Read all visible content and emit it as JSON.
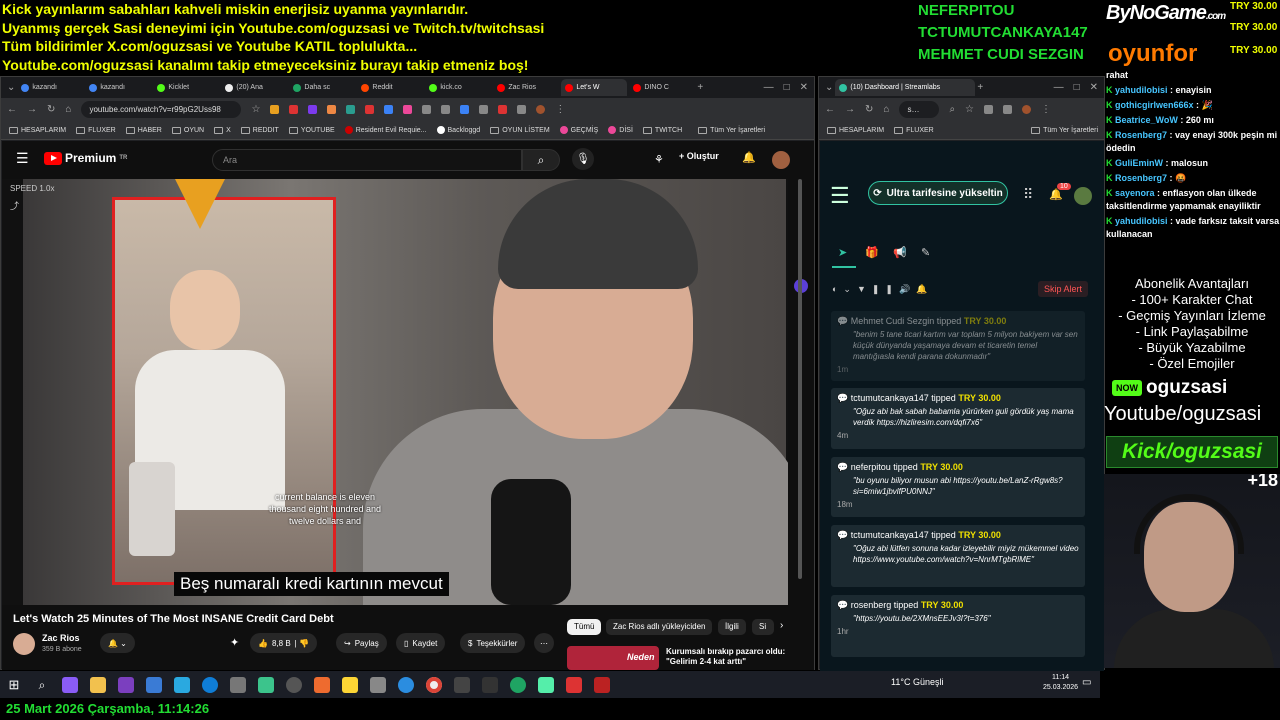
{
  "overlay": {
    "top_lines": [
      "Kick yayınlarım sabahları kahveli miskin enerjisiz uyanma yayınlarıdır.",
      "Uyanmış gerçek Sasi deneyimi için Youtube.com/oguzsasi ve Twitch.tv/twitchsasi",
      "Tüm bildirimler X.com/oguzsasi ve Youtube KATIL toplulukta...",
      "Youtube.com/oguzsasi kanalımı takip etmeyeceksiniz burayı takip etmeniz boş!"
    ],
    "top_donors": [
      "NEFERPITOU",
      "TCTUMUTCANKAYA147",
      "MEHMET CUDI SEZGIN"
    ],
    "sponsor_1": "ByNoGame",
    "sponsor_1_sub": ".com",
    "sponsor_2": "oyunfor",
    "tip_tags": [
      "TRY 30.00",
      "TRY 30.00",
      "TRY 30.00"
    ],
    "date_line": "25 Mart 2026 Çarşamba, 11:14:26"
  },
  "browser_left": {
    "tabs": [
      "kazandı",
      "kazandı",
      "Kicklet",
      "(20) Ana",
      "Daha sc",
      "Reddit",
      "kick.co",
      "Zac Rios",
      "Let's W",
      "DINO C"
    ],
    "url": "youtube.com/watch?v=r99pG2Uss98",
    "bookmarks": [
      "HESAPLARIM",
      "FLUXER",
      "HABER",
      "OYUN",
      "X",
      "REDDIT",
      "YOUTUBE",
      "Resident Evil Requie...",
      "Backloggd",
      "OYUN LİSTEM",
      "GEÇMİŞ",
      "DİSİ",
      "TWITCH",
      "Tüm Yer İşaretleri"
    ]
  },
  "youtube": {
    "brand": "Premium",
    "brand_sup": "TR",
    "search_placeholder": "Ara",
    "create_label": "Oluştur",
    "speed": "SPEED 1.0x",
    "inset_caption": "current balance is eleven thousand eight hundred and twelve dollars and",
    "subtitle": "Beş numaralı kredi kartının mevcut",
    "video_title": "Let's Watch 25 Minutes of The Most INSANE Credit Card Debt",
    "channel": "Zac Rios",
    "subscribers": "359 B abone",
    "likes": "8,8 B",
    "share_label": "Paylaş",
    "save_label": "Kaydet",
    "thanks_label": "Teşekkürler",
    "chips": [
      "Tümü",
      "Zac Rios adlı yükleyiciden",
      "İlgili",
      "Si"
    ],
    "rec_title": "Kurumsalı bırakıp pazarcı oldu: \"Gelirim 2-4 kat arttı\"",
    "rec_thumb_label": "Neden"
  },
  "browser_right": {
    "tab_title": "(10) Dashboard | Streamlabs",
    "bookmarks": [
      "HESAPLARIM",
      "FLUXER",
      "Tüm Yer İşaretleri"
    ]
  },
  "streamlabs": {
    "upgrade_label": "Ultra tarifesine yükseltin",
    "notif_count": "10",
    "skip_label": "Skip Alert",
    "tips": [
      {
        "user": "Mehmet Cudi Sezgin",
        "verb": "tipped",
        "amount": "TRY 30.00",
        "message": "\"benim 5 tane ticari kartım var toplam 5 milyon bakiyem var sen küçük dünyanda yaşamaya devam et ticaretin temel mantığıasla kendi parana dokunmadır\"",
        "ago": "1m",
        "faded": true
      },
      {
        "user": "tctumutcankaya147",
        "verb": "tipped",
        "amount": "TRY 30.00",
        "message": "\"Oğuz abi bak sabah babamla yürürken guli gördük yaş mama verdik https://hizliresim.com/dqfi7x6\"",
        "ago": "4m",
        "faded": false
      },
      {
        "user": "neferpitou",
        "verb": "tipped",
        "amount": "TRY 30.00",
        "message": "\"bu oyunu biliyor musun abi https://youtu.be/LanZ-rRgw8s?si=6miw1jbvlfPU0NNJ\"",
        "ago": "18m",
        "faded": false
      },
      {
        "user": "tctumutcankaya147",
        "verb": "tipped",
        "amount": "TRY 30.00",
        "message": "\"Oğuz abi lütfen sonuna kadar izleyebilir miyiz mükemmel video https://www.youtube.com/watch?v=NnrMTgbRlME\"",
        "ago": "21m",
        "faded": false
      },
      {
        "user": "rosenberg",
        "verb": "tipped",
        "amount": "TRY 30.00",
        "message": "\"https://youtu.be/2XMnsEEJv3I?t=376\"",
        "ago": "1hr",
        "faded": false
      }
    ]
  },
  "chat": {
    "messages": [
      {
        "user": "",
        "text": "rahat"
      },
      {
        "user": "yahudilobisi",
        "text": " : enayisin"
      },
      {
        "user": "gothicgirlwen666x",
        "text": " : 🎉"
      },
      {
        "user": "Beatrice_WoW",
        "text": " : 260 mı"
      },
      {
        "user": "Rosenberg7",
        "text": " : vay enayi 300k peşin mi ödedin"
      },
      {
        "user": "GuliEminW",
        "text": " : malosun"
      },
      {
        "user": "Rosenberg7",
        "text": " : 🤬"
      },
      {
        "user": "sayenora",
        "text": " : enflasyon olan ülkede taksitlendirme yapmamak enayiliktir"
      },
      {
        "user": "yahudilobisi",
        "text": " : vade farksız taksit varsa kullanacan"
      }
    ],
    "perks": [
      "Abonelik Avantajları",
      "- 100+ Karakter Chat",
      "- Geçmiş Yayınları İzleme",
      "- Link Paylaşabilme",
      "- Büyük Yazabilme",
      "- Özel Emojiler"
    ],
    "kick_badge": "NOW",
    "handle": "oguzsasi",
    "youtube_line": "Youtube/oguzsasi",
    "kick_line": "Kick/oguzsasi",
    "viewer_badge": "+18"
  },
  "taskbar": {
    "weather": "11°C  Güneşli",
    "time": "11:14",
    "date": "25.03.2026"
  }
}
